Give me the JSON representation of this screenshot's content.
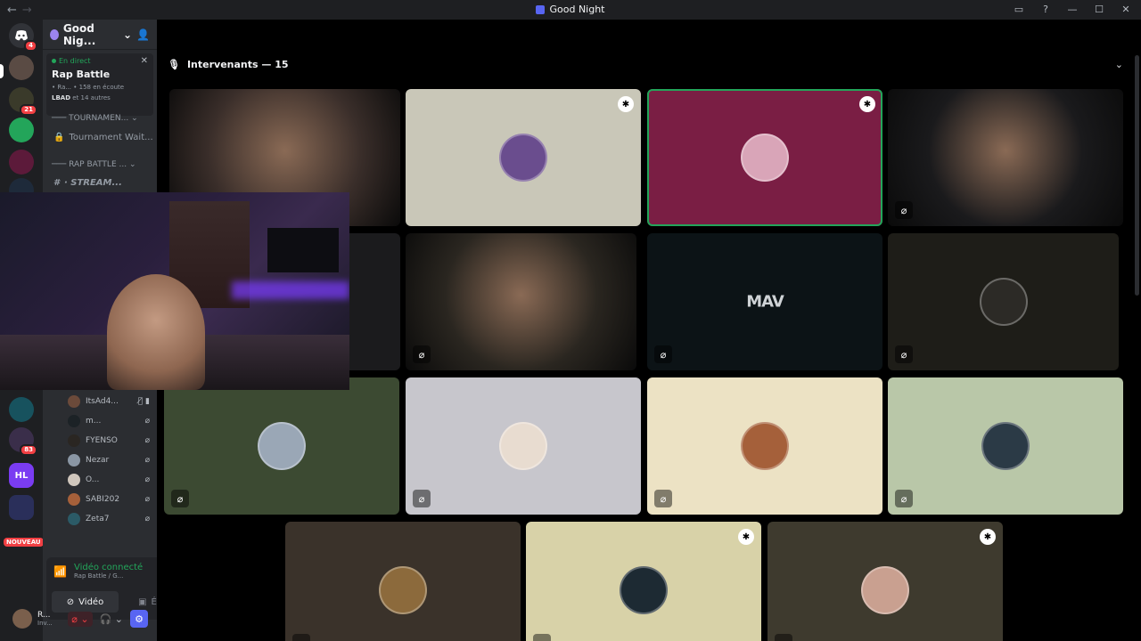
{
  "window": {
    "title": "Good Night",
    "nav_back": "←",
    "nav_forward": "→"
  },
  "rail": {
    "servers": [
      {
        "initials": "",
        "badge": "4",
        "name": "home"
      },
      {
        "initials": "",
        "badge": "",
        "name": "rap-battle"
      },
      {
        "initials": "",
        "badge": "21",
        "name": "server-21"
      },
      {
        "initials": "",
        "badge": "",
        "name": "server-green"
      },
      {
        "initials": "",
        "badge": "",
        "name": "server-boaters"
      },
      {
        "initials": "",
        "badge": "",
        "name": "server-video"
      },
      {
        "initials": "",
        "badge": "",
        "name": "server-blue"
      },
      {
        "initials": "",
        "badge": "83",
        "name": "server-83"
      },
      {
        "initials": "HL",
        "badge": "",
        "name": "server-hl"
      },
      {
        "initials": "",
        "badge": "",
        "name": "folder"
      }
    ],
    "new_badge": "NOUVEAU"
  },
  "sidebar": {
    "guild_name": "Good Nig...",
    "live_label": "En direct",
    "stage_title": "Rap Battle",
    "stage_meta_a": "• Ra...",
    "stage_meta_b": "• 158 en écoute",
    "stage_meta_user": "LBAD",
    "stage_meta_others": " et 14 autres",
    "cat1": "TOURNAMEN...",
    "chan1": "Tournament Wait...",
    "cat2": "RAP BATTLE ...",
    "chan2": "· STREAM...",
    "members": [
      {
        "name": "ItsAd4...",
        "video": true
      },
      {
        "name": "m...",
        "video": false
      },
      {
        "name": "FYENSO",
        "video": false
      },
      {
        "name": "Nezar",
        "video": false
      },
      {
        "name": "O...",
        "video": false
      },
      {
        "name": "SABI202",
        "video": false
      },
      {
        "name": "Zeta7",
        "video": false
      }
    ]
  },
  "voice": {
    "status": "Vidéo connecté",
    "location": "Rap Battle / G...",
    "video_label": "Vidéo",
    "screen_label": "Écran"
  },
  "user": {
    "name": "R...",
    "status": "Inv..."
  },
  "stage": {
    "header": "Intervenants — 15",
    "logo_text": "MAV",
    "tiles": [
      {
        "bg": "#3a2e2a",
        "camera": true,
        "muted": false,
        "mod": false,
        "speaking": false
      },
      {
        "bg": "#c9c7b8",
        "camera": false,
        "muted": false,
        "mod": true,
        "speaking": false,
        "avatar": "#6a4d8e"
      },
      {
        "bg": "#7a1e44",
        "camera": false,
        "muted": false,
        "mod": true,
        "speaking": true,
        "avatar": "#d9a5b8"
      },
      {
        "bg": "#1a1a1c",
        "camera": true,
        "muted": true,
        "mod": false,
        "speaking": false
      },
      {
        "bg": "#1b1b1d",
        "camera": false,
        "muted": false,
        "mod": false,
        "speaking": false
      },
      {
        "bg": "#2a2620",
        "camera": true,
        "muted": true,
        "mod": false,
        "speaking": false
      },
      {
        "bg": "#0c1316",
        "camera": false,
        "muted": true,
        "mod": false,
        "speaking": false,
        "logo": true
      },
      {
        "bg": "#1e1d18",
        "camera": false,
        "muted": true,
        "mod": false,
        "speaking": false,
        "avatar": "#2c2a26"
      },
      {
        "bg": "#3c4a32",
        "camera": false,
        "muted": true,
        "mod": false,
        "speaking": false,
        "avatar": "#9aa7b6"
      },
      {
        "bg": "#c7c6cc",
        "camera": false,
        "muted": true,
        "mod": false,
        "speaking": false,
        "avatar": "#e8dcd0"
      },
      {
        "bg": "#ece2c4",
        "camera": false,
        "muted": true,
        "mod": false,
        "speaking": false,
        "avatar": "#a5603a"
      },
      {
        "bg": "#b9c7a8",
        "camera": false,
        "muted": true,
        "mod": false,
        "speaking": false,
        "avatar": "#2b3a46"
      },
      {
        "bg": "#3a322a",
        "camera": false,
        "muted": true,
        "mod": false,
        "speaking": false,
        "avatar": "#8c6a3c"
      },
      {
        "bg": "#d8d2a8",
        "camera": false,
        "muted": true,
        "mod": true,
        "speaking": false,
        "avatar": "#1d2a33"
      },
      {
        "bg": "#3e3a2e",
        "camera": false,
        "muted": true,
        "mod": true,
        "speaking": false,
        "avatar": "#c9a090"
      }
    ]
  }
}
